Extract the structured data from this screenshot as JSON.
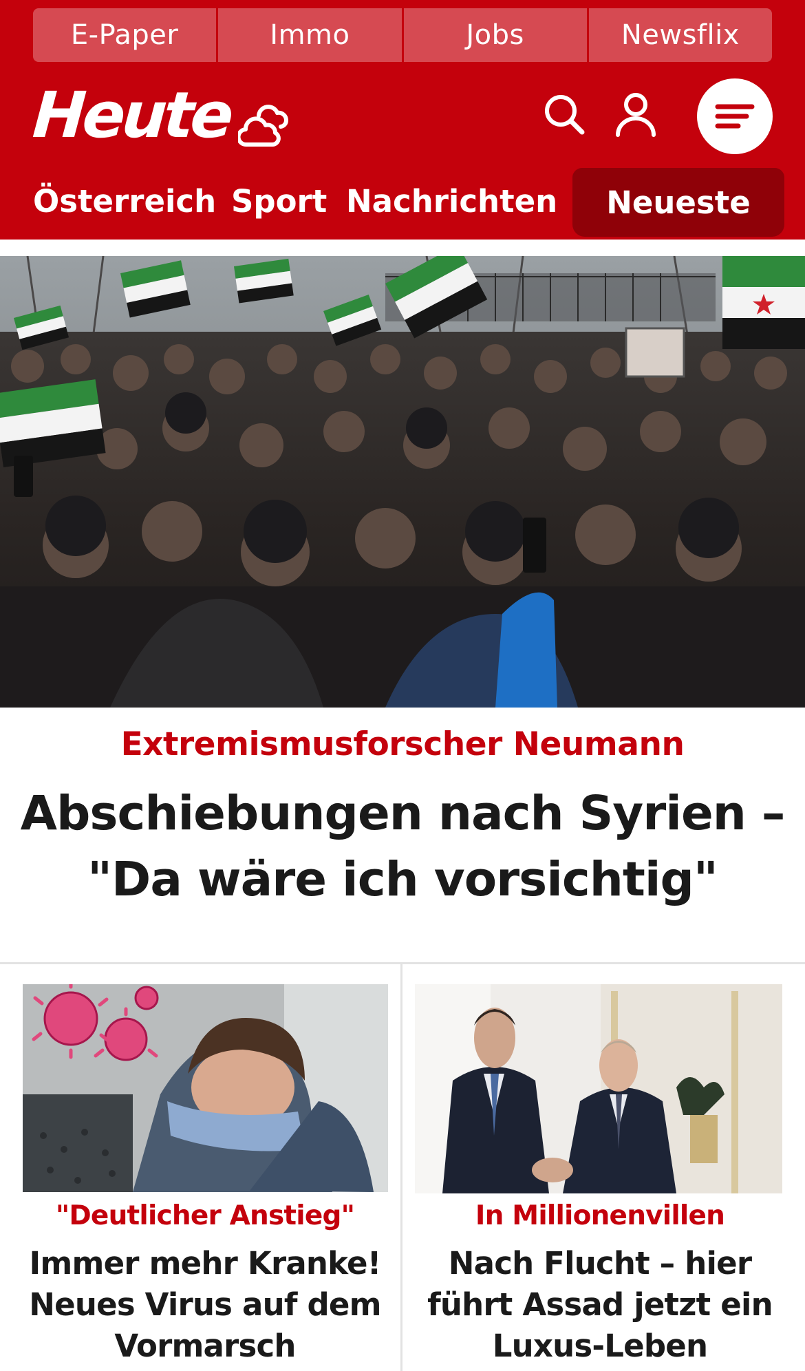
{
  "services": [
    "E-Paper",
    "Immo",
    "Jobs",
    "Newsflix"
  ],
  "brand": {
    "logo": "Heute"
  },
  "nav": {
    "items": [
      "Österreich",
      "Sport",
      "Nachrichten"
    ],
    "active": "Neueste"
  },
  "hero": {
    "kicker": "Extremismusforscher Neumann",
    "title": "Abschiebungen nach Syrien – \"Da wäre ich vorsichtig\""
  },
  "teasers": [
    {
      "kicker": "\"Deutlicher Anstieg\"",
      "title": "Immer mehr Kranke! Neues Virus auf dem Vormarsch"
    },
    {
      "kicker": "In Millionenvillen",
      "title": "Nach Flucht – hier führt Assad jetzt ein Luxus-Leben"
    }
  ],
  "icons": [
    "weather-cloud-icon",
    "search-icon",
    "user-icon",
    "menu-icon"
  ],
  "colors": {
    "brand_red": "#c4010c",
    "service_bg": "#d64a52",
    "nav_active_bg": "#8f0108",
    "text_dark": "#1a1a1a"
  }
}
